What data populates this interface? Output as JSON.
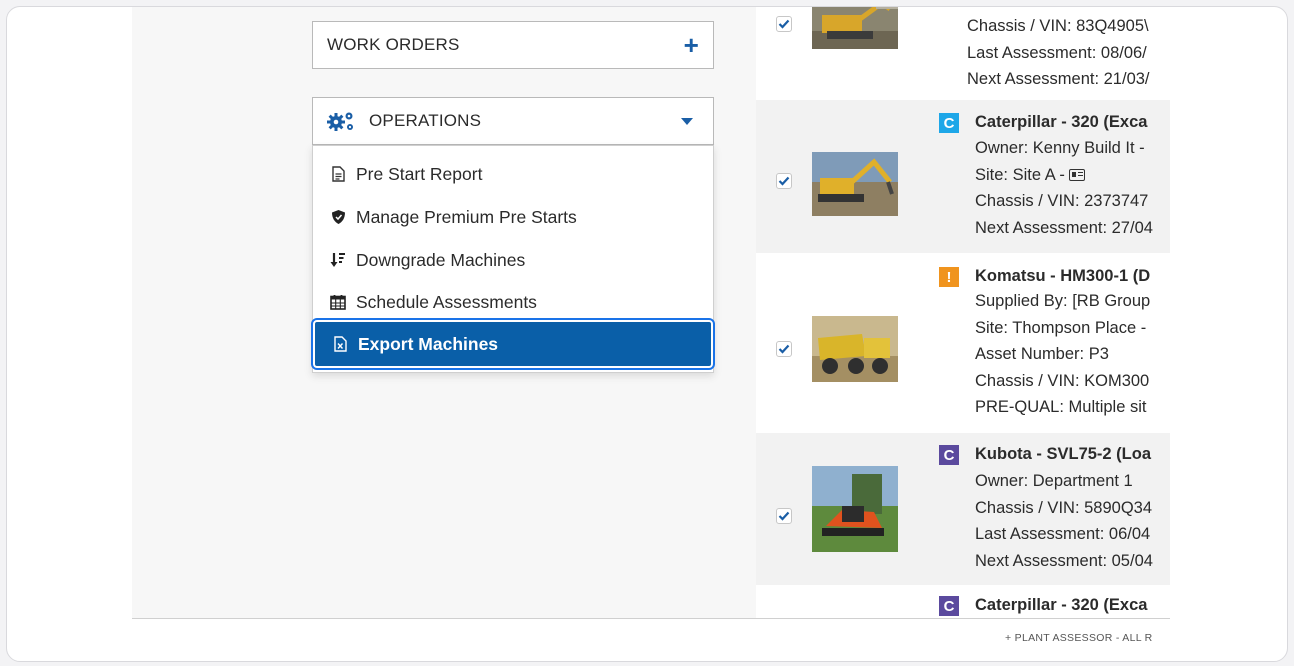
{
  "left": {
    "work_orders": {
      "label": "WORK ORDERS",
      "icon": "plus-icon"
    },
    "operations": {
      "label": "OPERATIONS",
      "icon": "gears-icon"
    },
    "menu": [
      {
        "label": "Pre Start Report",
        "icon": "document-icon"
      },
      {
        "label": "Manage Premium Pre Starts",
        "icon": "shield-icon"
      },
      {
        "label": "Downgrade Machines",
        "icon": "sort-down-icon"
      },
      {
        "label": "Schedule Assessments",
        "icon": "calendar-icon"
      },
      {
        "label": "Export Machines",
        "icon": "excel-file-icon"
      }
    ]
  },
  "machines": [
    {
      "badge": "",
      "title": "",
      "lines": [
        "Chassis / VIN: 83Q4905\\",
        "Last Assessment: 08/06/",
        "Next Assessment: 21/03/"
      ]
    },
    {
      "badge": "C",
      "badge_color": "#1ea7e8",
      "title": "Caterpillar - 320 (Exca",
      "lines": [
        "Owner: Kenny Build It -",
        "Site: Site A -",
        "Chassis / VIN: 2373747",
        "Next Assessment: 27/04"
      ]
    },
    {
      "badge": "!",
      "badge_color": "#f0941e",
      "title": "Komatsu - HM300-1 (D",
      "lines": [
        "Supplied By: [RB Group",
        "Site: Thompson Place -",
        "Asset Number: P3",
        "Chassis / VIN: KOM300",
        "PRE-QUAL: Multiple sit"
      ]
    },
    {
      "badge": "C",
      "badge_color": "#5b4a9e",
      "title": "Kubota - SVL75-2 (Loa",
      "lines": [
        "Owner: Department 1",
        "Chassis / VIN: 5890Q34",
        "Last Assessment: 06/04",
        "Next Assessment: 05/04"
      ]
    },
    {
      "badge": "C",
      "badge_color": "#5b4a9e",
      "title": "Caterpillar - 320 (Exca",
      "lines": []
    }
  ],
  "footer": "+ PLANT ASSESSOR - ALL R",
  "colors": {
    "accent": "#0a5fa8",
    "focus_ring": "#1a73e8"
  }
}
